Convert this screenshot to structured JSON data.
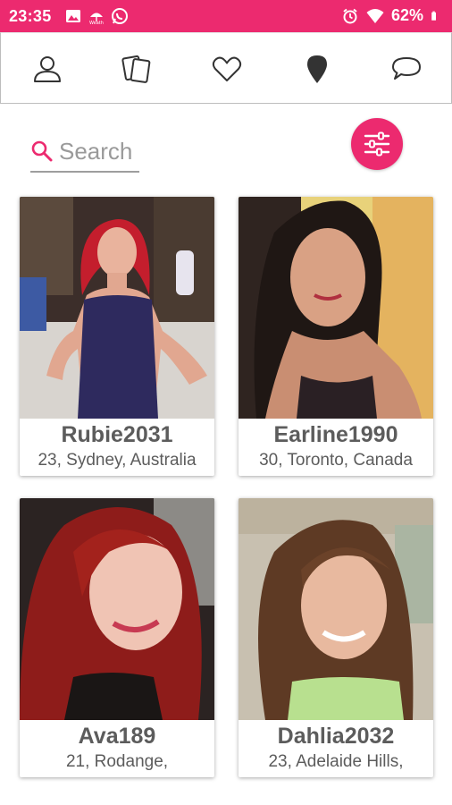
{
  "status_bar": {
    "time": "23:35",
    "battery": "62%",
    "background": "#ec2a6f",
    "left_icons": [
      "image-icon",
      "weather-icon",
      "whatsapp-icon"
    ],
    "right_icons": [
      "alarm-icon",
      "wifi-icon",
      "battery-icon"
    ]
  },
  "nav": {
    "items": [
      "profile-icon",
      "cards-icon",
      "heart-icon",
      "location-pin-icon",
      "chat-bubble-icon"
    ]
  },
  "search": {
    "placeholder": "Search",
    "value": ""
  },
  "accent_color": "#ec2a6f",
  "profiles": [
    {
      "username": "Rubie2031",
      "details": "23, Sydney, Australia"
    },
    {
      "username": "Earline1990",
      "details": "30, Toronto, Canada"
    },
    {
      "username": "Ava189",
      "details": "21, Rodange,"
    },
    {
      "username": "Dahlia2032",
      "details": "23, Adelaide Hills,"
    }
  ]
}
